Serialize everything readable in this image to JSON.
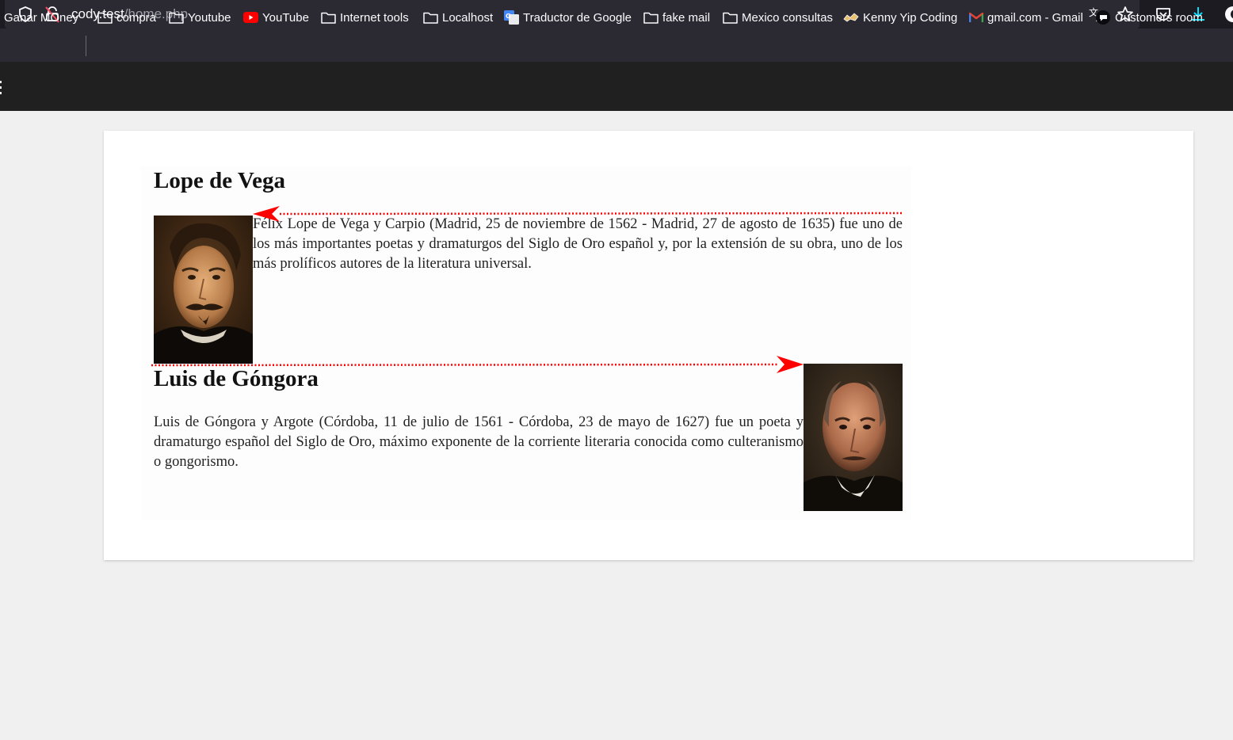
{
  "browser": {
    "url_host": "cody.test",
    "url_path": "/home.php",
    "icons": {
      "tracking": "shield-icon",
      "connection": "lock-broken-icon",
      "translate": "translate-icon",
      "bookmark": "star-icon",
      "pocket": "pocket-icon",
      "downloads": "download-icon"
    },
    "bookmarks": [
      {
        "label": "Ganar MOney",
        "icon": "none"
      },
      {
        "label": "compra",
        "icon": "folder-icon"
      },
      {
        "label": "Youtube",
        "icon": "folder-icon"
      },
      {
        "label": "YouTube",
        "icon": "youtube-icon"
      },
      {
        "label": "Internet tools",
        "icon": "folder-icon"
      },
      {
        "label": "Localhost",
        "icon": "folder-icon"
      },
      {
        "label": "Traductor de Google",
        "icon": "google-translate-icon"
      },
      {
        "label": "fake mail",
        "icon": "folder-icon"
      },
      {
        "label": "Mexico consultas",
        "icon": "folder-icon"
      },
      {
        "label": "Kenny Yip Coding",
        "icon": "kenny-icon"
      },
      {
        "label": "gmail.com - Gmail",
        "icon": "gmail-icon"
      },
      {
        "label": "Customers room",
        "icon": "chat-bubble-icon"
      }
    ]
  },
  "page": {
    "sections": [
      {
        "title": "Lope de Vega",
        "text": "Félix Lope de Vega y Carpio (Madrid, 25 de noviembre de 1562 - Madrid, 27 de agosto de 1635) fue uno de los más importantes poetas y dramaturgos del Siglo de Oro español y, por la extensión de su obra, uno de los más prolíficos autores de la literatura universal."
      },
      {
        "title": "Luis de Góngora",
        "text": "Luis de Góngora y Argote (Córdoba, 11 de julio de 1561 - Córdoba, 23 de mayo de 1627) fue un poeta y dramaturgo español del Siglo de Oro, máximo exponente de la corriente literaria conocida como culteranismo o gongorismo."
      }
    ],
    "annotation_color": "#ff0000"
  }
}
